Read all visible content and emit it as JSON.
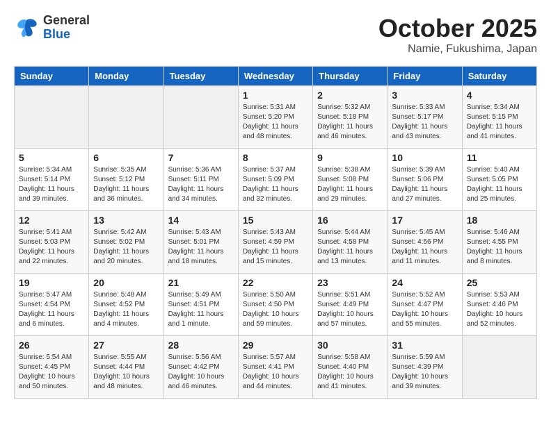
{
  "header": {
    "logo_general": "General",
    "logo_blue": "Blue",
    "month": "October 2025",
    "location": "Namie, Fukushima, Japan"
  },
  "weekdays": [
    "Sunday",
    "Monday",
    "Tuesday",
    "Wednesday",
    "Thursday",
    "Friday",
    "Saturday"
  ],
  "weeks": [
    [
      {
        "day": "",
        "info": ""
      },
      {
        "day": "",
        "info": ""
      },
      {
        "day": "",
        "info": ""
      },
      {
        "day": "1",
        "info": "Sunrise: 5:31 AM\nSunset: 5:20 PM\nDaylight: 11 hours\nand 48 minutes."
      },
      {
        "day": "2",
        "info": "Sunrise: 5:32 AM\nSunset: 5:18 PM\nDaylight: 11 hours\nand 46 minutes."
      },
      {
        "day": "3",
        "info": "Sunrise: 5:33 AM\nSunset: 5:17 PM\nDaylight: 11 hours\nand 43 minutes."
      },
      {
        "day": "4",
        "info": "Sunrise: 5:34 AM\nSunset: 5:15 PM\nDaylight: 11 hours\nand 41 minutes."
      }
    ],
    [
      {
        "day": "5",
        "info": "Sunrise: 5:34 AM\nSunset: 5:14 PM\nDaylight: 11 hours\nand 39 minutes."
      },
      {
        "day": "6",
        "info": "Sunrise: 5:35 AM\nSunset: 5:12 PM\nDaylight: 11 hours\nand 36 minutes."
      },
      {
        "day": "7",
        "info": "Sunrise: 5:36 AM\nSunset: 5:11 PM\nDaylight: 11 hours\nand 34 minutes."
      },
      {
        "day": "8",
        "info": "Sunrise: 5:37 AM\nSunset: 5:09 PM\nDaylight: 11 hours\nand 32 minutes."
      },
      {
        "day": "9",
        "info": "Sunrise: 5:38 AM\nSunset: 5:08 PM\nDaylight: 11 hours\nand 29 minutes."
      },
      {
        "day": "10",
        "info": "Sunrise: 5:39 AM\nSunset: 5:06 PM\nDaylight: 11 hours\nand 27 minutes."
      },
      {
        "day": "11",
        "info": "Sunrise: 5:40 AM\nSunset: 5:05 PM\nDaylight: 11 hours\nand 25 minutes."
      }
    ],
    [
      {
        "day": "12",
        "info": "Sunrise: 5:41 AM\nSunset: 5:03 PM\nDaylight: 11 hours\nand 22 minutes."
      },
      {
        "day": "13",
        "info": "Sunrise: 5:42 AM\nSunset: 5:02 PM\nDaylight: 11 hours\nand 20 minutes."
      },
      {
        "day": "14",
        "info": "Sunrise: 5:43 AM\nSunset: 5:01 PM\nDaylight: 11 hours\nand 18 minutes."
      },
      {
        "day": "15",
        "info": "Sunrise: 5:43 AM\nSunset: 4:59 PM\nDaylight: 11 hours\nand 15 minutes."
      },
      {
        "day": "16",
        "info": "Sunrise: 5:44 AM\nSunset: 4:58 PM\nDaylight: 11 hours\nand 13 minutes."
      },
      {
        "day": "17",
        "info": "Sunrise: 5:45 AM\nSunset: 4:56 PM\nDaylight: 11 hours\nand 11 minutes."
      },
      {
        "day": "18",
        "info": "Sunrise: 5:46 AM\nSunset: 4:55 PM\nDaylight: 11 hours\nand 8 minutes."
      }
    ],
    [
      {
        "day": "19",
        "info": "Sunrise: 5:47 AM\nSunset: 4:54 PM\nDaylight: 11 hours\nand 6 minutes."
      },
      {
        "day": "20",
        "info": "Sunrise: 5:48 AM\nSunset: 4:52 PM\nDaylight: 11 hours\nand 4 minutes."
      },
      {
        "day": "21",
        "info": "Sunrise: 5:49 AM\nSunset: 4:51 PM\nDaylight: 11 hours\nand 1 minute."
      },
      {
        "day": "22",
        "info": "Sunrise: 5:50 AM\nSunset: 4:50 PM\nDaylight: 10 hours\nand 59 minutes."
      },
      {
        "day": "23",
        "info": "Sunrise: 5:51 AM\nSunset: 4:49 PM\nDaylight: 10 hours\nand 57 minutes."
      },
      {
        "day": "24",
        "info": "Sunrise: 5:52 AM\nSunset: 4:47 PM\nDaylight: 10 hours\nand 55 minutes."
      },
      {
        "day": "25",
        "info": "Sunrise: 5:53 AM\nSunset: 4:46 PM\nDaylight: 10 hours\nand 52 minutes."
      }
    ],
    [
      {
        "day": "26",
        "info": "Sunrise: 5:54 AM\nSunset: 4:45 PM\nDaylight: 10 hours\nand 50 minutes."
      },
      {
        "day": "27",
        "info": "Sunrise: 5:55 AM\nSunset: 4:44 PM\nDaylight: 10 hours\nand 48 minutes."
      },
      {
        "day": "28",
        "info": "Sunrise: 5:56 AM\nSunset: 4:42 PM\nDaylight: 10 hours\nand 46 minutes."
      },
      {
        "day": "29",
        "info": "Sunrise: 5:57 AM\nSunset: 4:41 PM\nDaylight: 10 hours\nand 44 minutes."
      },
      {
        "day": "30",
        "info": "Sunrise: 5:58 AM\nSunset: 4:40 PM\nDaylight: 10 hours\nand 41 minutes."
      },
      {
        "day": "31",
        "info": "Sunrise: 5:59 AM\nSunset: 4:39 PM\nDaylight: 10 hours\nand 39 minutes."
      },
      {
        "day": "",
        "info": ""
      }
    ]
  ]
}
